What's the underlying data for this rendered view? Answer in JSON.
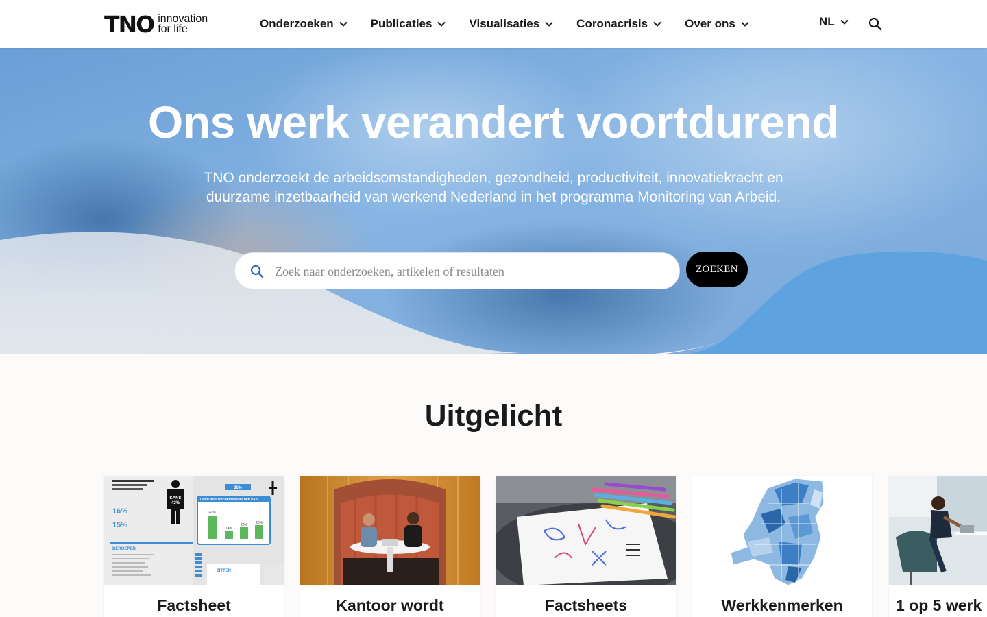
{
  "nav": {
    "logo_mark": "TNO",
    "logo_tagline_1": "innovation",
    "logo_tagline_2": "for life",
    "menu": [
      {
        "label": "Onderzoeken"
      },
      {
        "label": "Publicaties"
      },
      {
        "label": "Visualisaties"
      },
      {
        "label": "Coronacrisis"
      },
      {
        "label": "Over ons"
      }
    ],
    "language": "NL"
  },
  "hero": {
    "title": "Ons werk verandert voortdurend",
    "subtitle": "TNO onderzoekt de arbeidsomstandigheden, gezondheid, productiviteit, innovatiekracht en duurzame inzetbaarheid van werkend Nederland in het programma Monitoring van Arbeid.",
    "search_placeholder": "Zoek naar onderzoeken, artikelen of resultaten",
    "search_value": "",
    "search_button": "ZOEKEN"
  },
  "featured": {
    "title": "Uitgelicht",
    "cards": [
      {
        "title": "Factsheet"
      },
      {
        "title": "Kantoor wordt"
      },
      {
        "title": "Factsheets"
      },
      {
        "title": "Werkkenmerken"
      },
      {
        "title": "1 op 5 werk"
      }
    ]
  },
  "infographic": {
    "kans_label": "KANS",
    "kans_value": "43%",
    "uren_title": "UREN BEELDSCHERMWERK PER DAG",
    "stat_1": "16%",
    "stat_2": "15%",
    "bar_values": [
      "42%",
      "14%",
      "20%",
      "25%"
    ],
    "beroepen_label": "BEROEPEN",
    "zitten_label": "ZITTEN",
    "pct_36": "36%"
  },
  "colors": {
    "accent_blue": "#4a90d9",
    "wave_blue": "#5ea2e0",
    "button_black": "#000000"
  }
}
